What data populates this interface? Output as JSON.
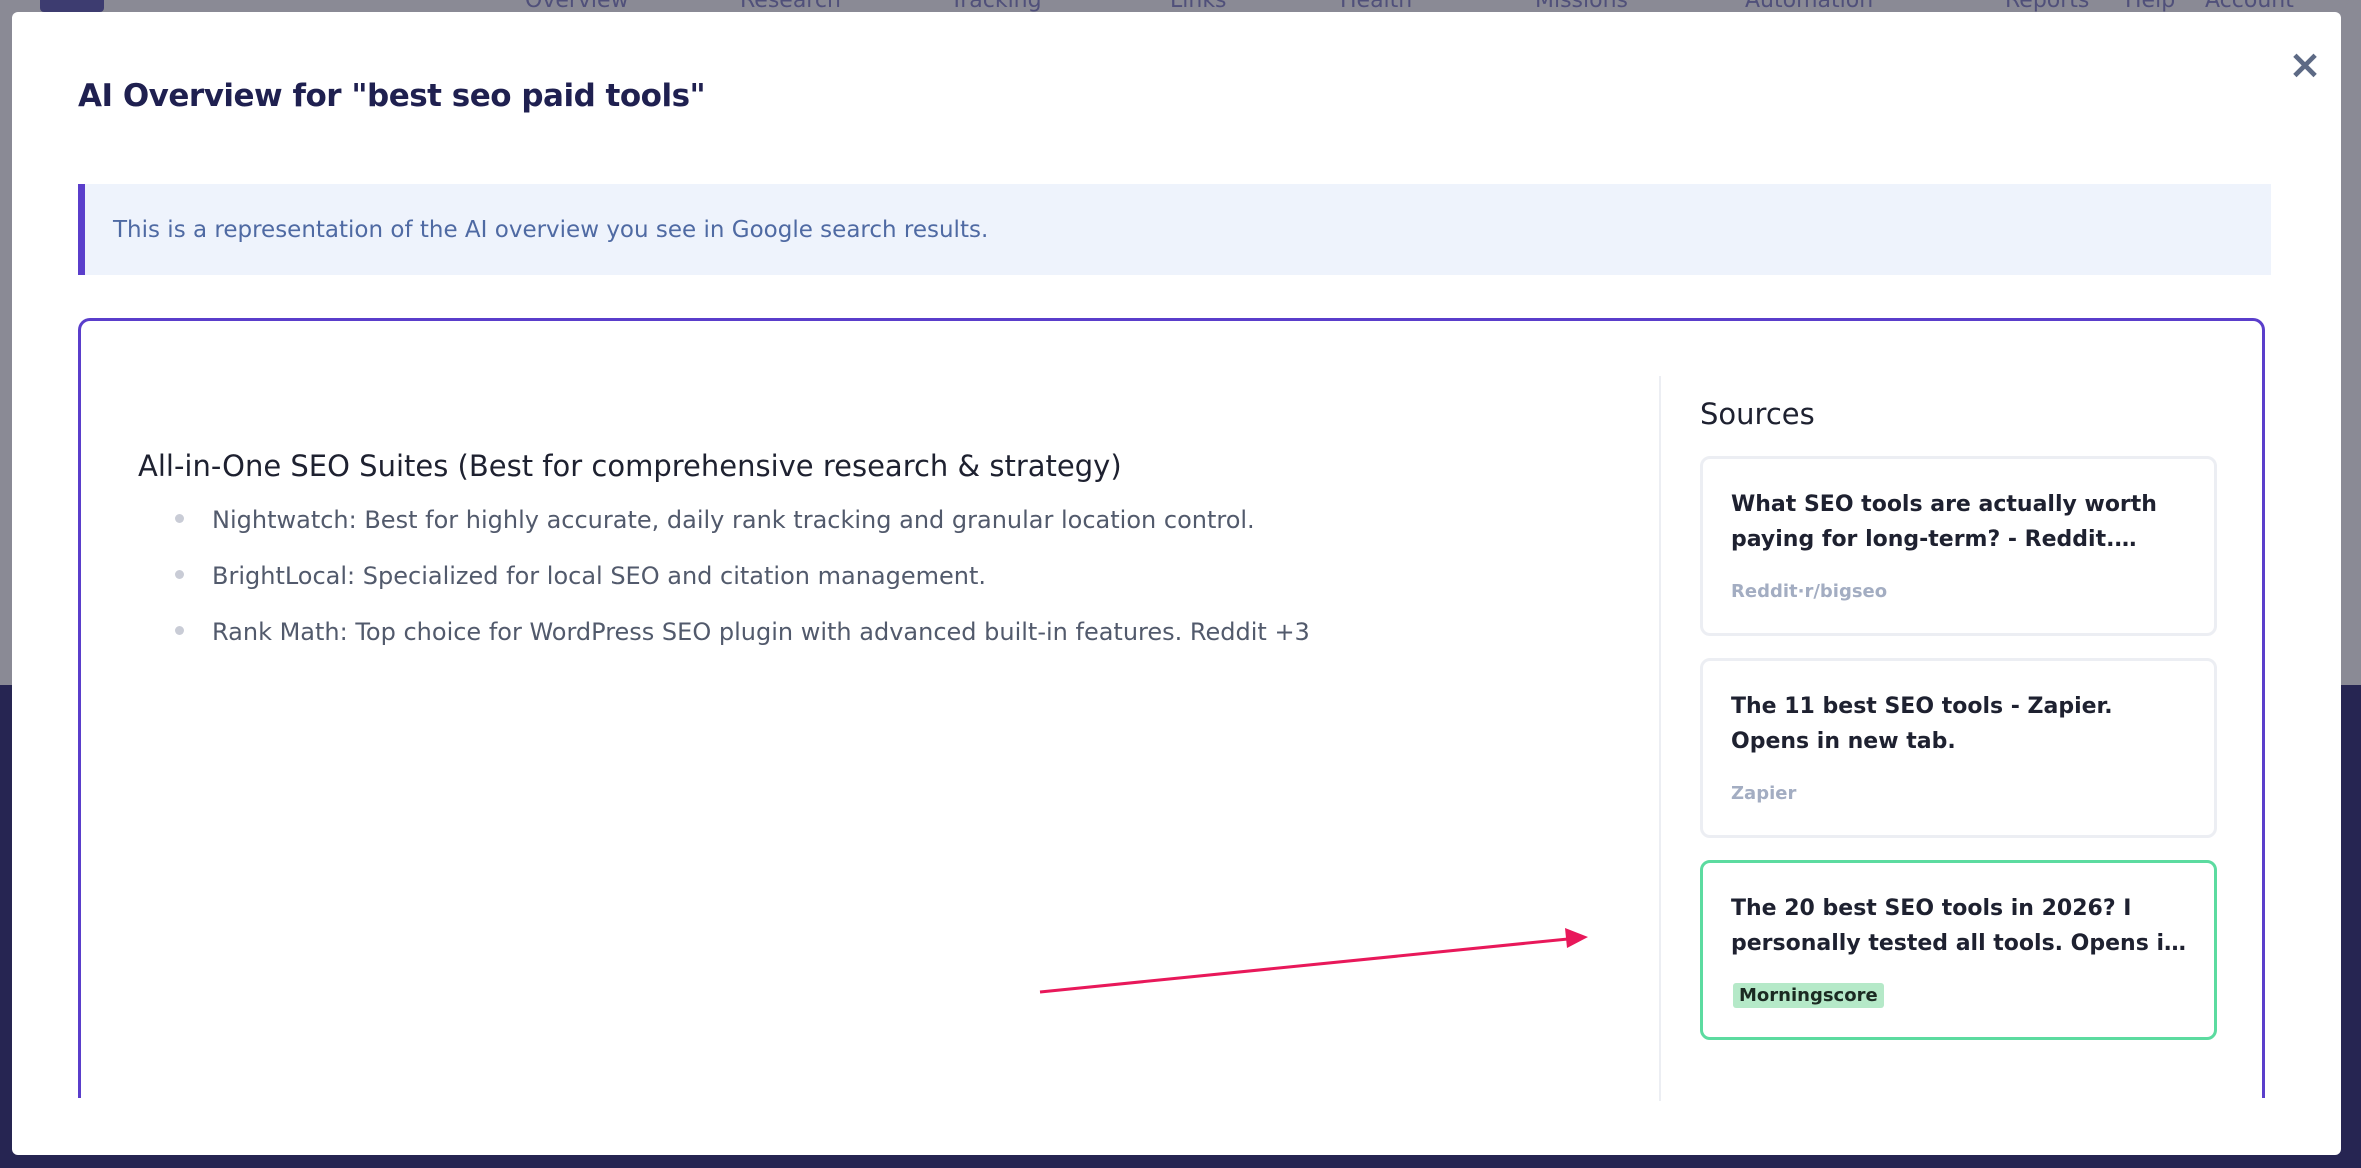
{
  "background_nav": {
    "items": [
      "Overview",
      "Research",
      "Tracking",
      "Links",
      "Health",
      "Missions",
      "Automation"
    ],
    "right_items": [
      "Reports",
      "Help",
      "Account"
    ]
  },
  "modal": {
    "title": "AI Overview for \"best seo paid tools\"",
    "close_icon": "close-icon",
    "close_glyph": "×",
    "notice": "This is a representation of the AI overview you see in Google search results."
  },
  "overview": {
    "heading": "All-in-One SEO Suites (Best for comprehensive research & strategy)",
    "bullets": [
      "Nightwatch: Best for highly accurate, daily rank tracking and granular location control.",
      "BrightLocal: Specialized for local SEO and citation management.",
      "Rank Math: Top choice for WordPress SEO plugin with advanced built-in features. Reddit +3"
    ]
  },
  "sources": {
    "title": "Sources",
    "items": [
      {
        "title": "What SEO tools are actually worth paying for long-term? - Reddit. Opens in new tab.",
        "domain": "Reddit·r/bigseo",
        "highlighted": false
      },
      {
        "title": "The 11 best SEO tools - Zapier. Opens in new tab.",
        "domain": "Zapier",
        "highlighted": false
      },
      {
        "title": "The 20 best SEO tools in 2026? I personally tested all tools. Opens in new tab.",
        "domain": "Morningscore",
        "highlighted": true
      }
    ]
  },
  "colors": {
    "accent": "#5a3ecb",
    "highlight_border": "#5cdba0",
    "arrow": "#e8185a",
    "title_text": "#1f2050"
  }
}
